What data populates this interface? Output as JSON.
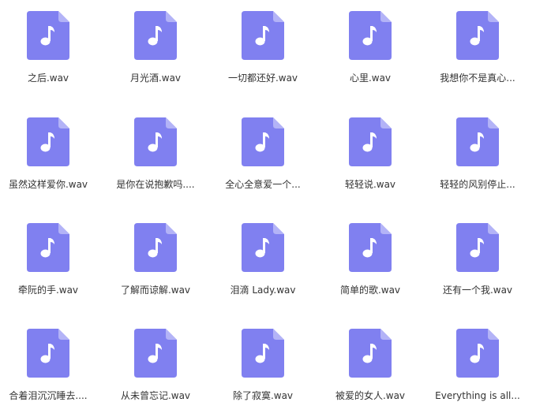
{
  "colors": {
    "icon_body": "#8080f0",
    "icon_fold": "#b3b3f7",
    "note": "#ffffff",
    "label_text": "#333333"
  },
  "icon_name": "music-file-icon",
  "files": [
    {
      "label": "之后.wav"
    },
    {
      "label": "月光酒.wav"
    },
    {
      "label": "一切都还好.wav"
    },
    {
      "label": "心里.wav"
    },
    {
      "label": "我想你不是真心..."
    },
    {
      "label": "虽然这样爱你.wav"
    },
    {
      "label": "是你在说抱歉吗...."
    },
    {
      "label": "全心全意爱一个..."
    },
    {
      "label": "轻轻说.wav"
    },
    {
      "label": "轻轻的风别停止..."
    },
    {
      "label": "牵阮的手.wav"
    },
    {
      "label": "了解而谅解.wav"
    },
    {
      "label": "泪滴 Lady.wav"
    },
    {
      "label": "简单的歌.wav"
    },
    {
      "label": "还有一个我.wav"
    },
    {
      "label": "合着泪沉沉睡去...."
    },
    {
      "label": "从未曾忘记.wav"
    },
    {
      "label": "除了寂寞.wav"
    },
    {
      "label": "被爱的女人.wav"
    },
    {
      "label": "Everything is all..."
    }
  ]
}
